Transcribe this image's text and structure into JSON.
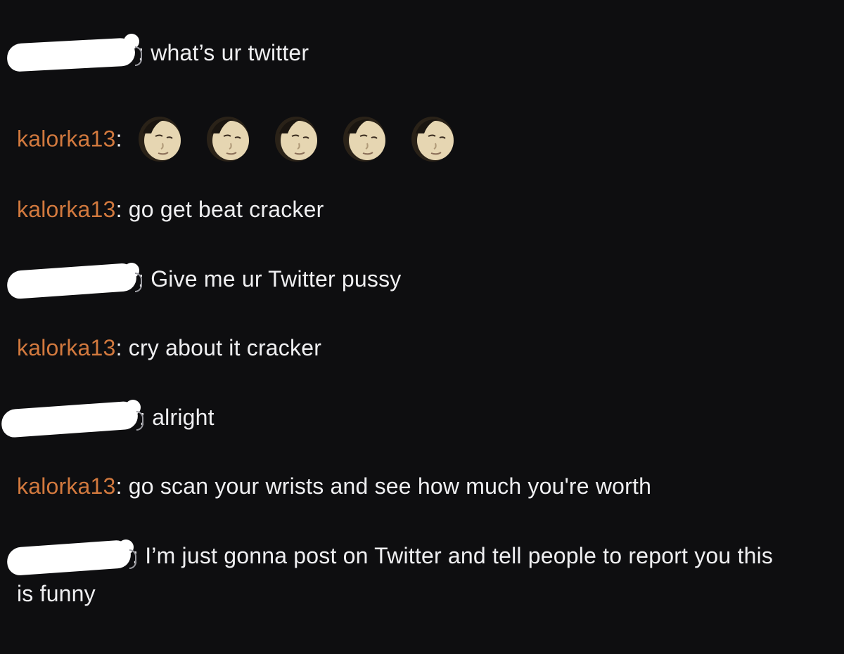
{
  "chat": {
    "messages": [
      {
        "user": "",
        "redacted": true,
        "separator": ":",
        "text": "what’s ur twitter"
      },
      {
        "user": "kalorka13",
        "redacted": false,
        "separator": ":",
        "text": "",
        "emotes": [
          "face-emote",
          "face-emote",
          "face-emote",
          "face-emote",
          "face-emote"
        ]
      },
      {
        "user": "kalorka13",
        "redacted": false,
        "separator": ":",
        "text": "go get beat cracker"
      },
      {
        "user": "",
        "redacted": true,
        "separator": ":",
        "text": "Give me ur Twitter pussy"
      },
      {
        "user": "kalorka13",
        "redacted": false,
        "separator": ":",
        "text": "cry about it cracker"
      },
      {
        "user": "",
        "redacted": true,
        "separator": ":",
        "text": "alright"
      },
      {
        "user": "kalorka13",
        "redacted": false,
        "separator": ":",
        "text": "go scan your wrists and see how much you're worth"
      },
      {
        "user": "",
        "redacted": true,
        "separator": ":",
        "text": "I’m just gonna post on Twitter and tell people to report you this is funny"
      }
    ]
  },
  "colors": {
    "background": "#0e0e10",
    "username": "#d2793e",
    "text": "#efeff1",
    "redaction": "#ffffff"
  }
}
